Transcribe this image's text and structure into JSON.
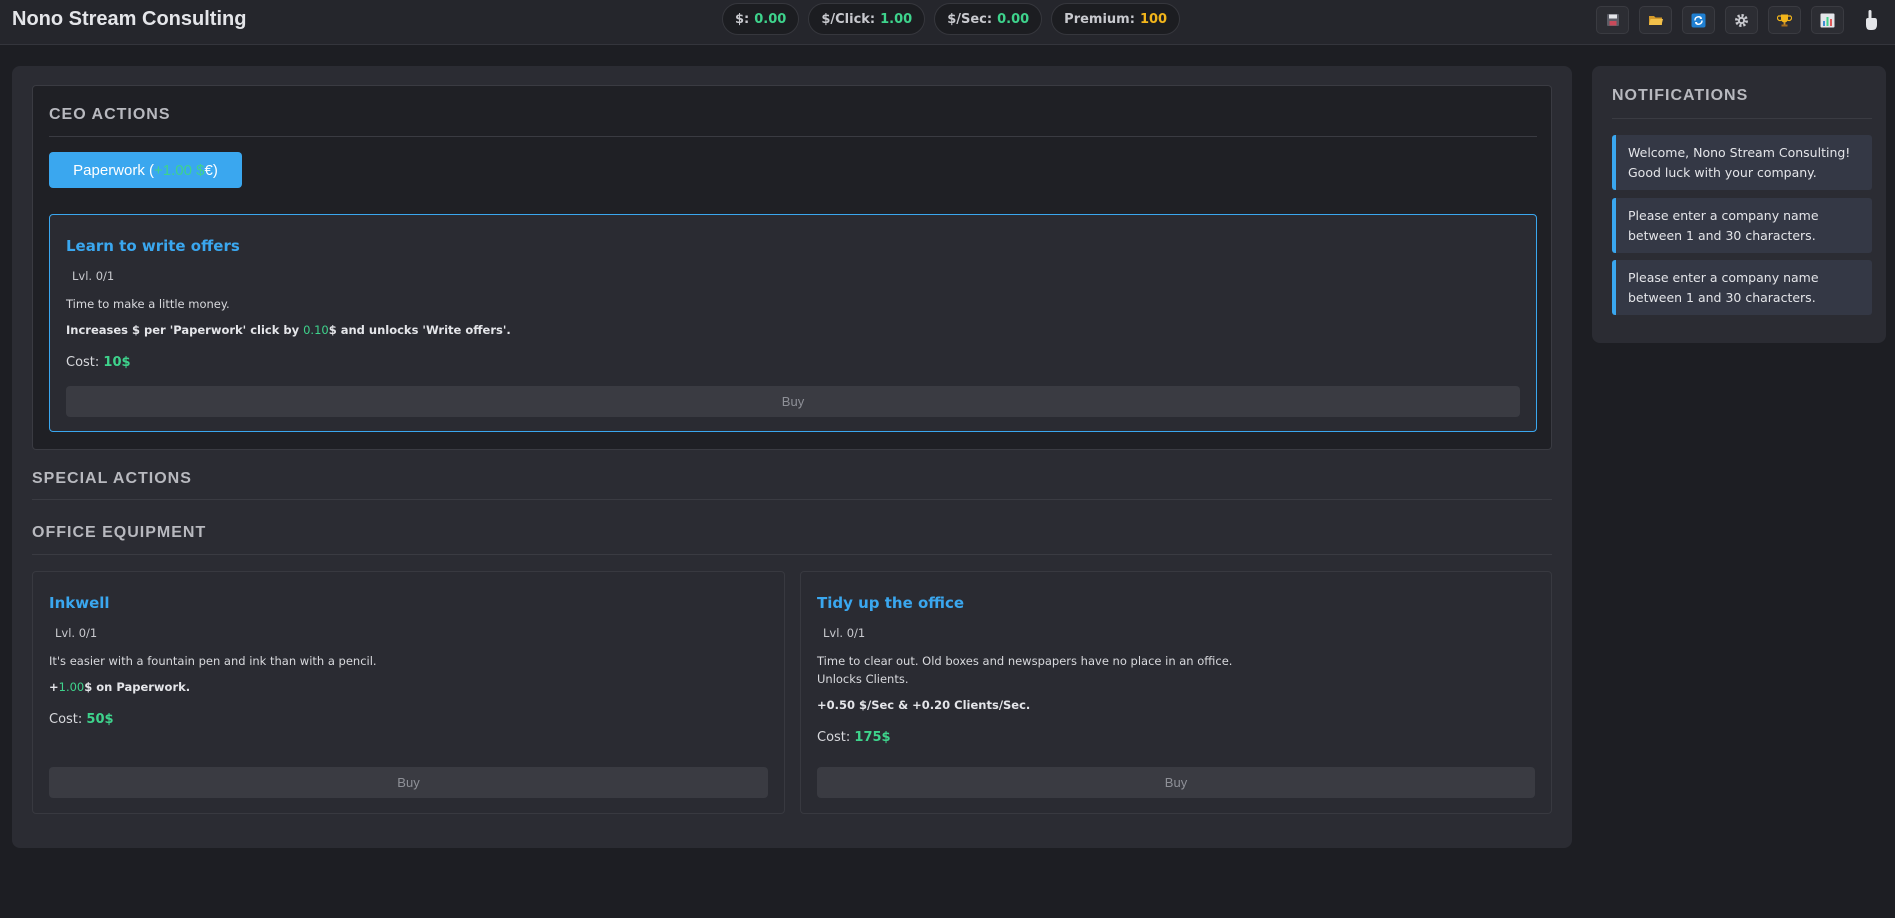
{
  "header": {
    "title": "Nono Stream Consulting",
    "stats": [
      {
        "label": "$:",
        "value": "0.00"
      },
      {
        "label": "$/Click:",
        "value": "1.00"
      },
      {
        "label": "$/Sec:",
        "value": "0.00"
      },
      {
        "label": "Premium:",
        "value": "100"
      }
    ],
    "toolbar_icons": [
      "save-icon",
      "folder-icon",
      "refresh-icon",
      "gear-icon",
      "trophy-icon",
      "chart-icon",
      "hand-icon"
    ]
  },
  "ceo": {
    "title": "CEO ACTIONS",
    "paperwork_button": {
      "label": "Paperwork (",
      "gain": "+1.00 $",
      "suffix": " €)"
    },
    "upgrade": {
      "title": "Learn to write offers",
      "level": "Lvl. 0/1",
      "description": "Time to make a little money.",
      "effect_prefix": "Increases $ per 'Paperwork' click by ",
      "effect_value": "0.10",
      "effect_suffix": "$ and unlocks 'Write offers'.",
      "cost_label": "Cost: ",
      "cost_value": "10$",
      "buy_label": "Buy"
    }
  },
  "special": {
    "title": "SPECIAL ACTIONS"
  },
  "office": {
    "title": "OFFICE EQUIPMENT",
    "items": [
      {
        "title": "Inkwell",
        "level": "Lvl. 0/1",
        "description": "It's easier with a fountain pen and ink than with a pencil.",
        "effect_prefix": "+",
        "effect_value": "1.00",
        "effect_suffix": "$ on Paperwork.",
        "cost_label": "Cost: ",
        "cost_value": "50$",
        "buy_label": "Buy"
      },
      {
        "title": "Tidy up the office",
        "level": "Lvl. 0/1",
        "description": "Time to clear out. Old boxes and newspapers have no place in an office.",
        "description2": "Unlocks Clients.",
        "effect": "+0.50 $/Sec & +0.20 Clients/Sec.",
        "cost_label": "Cost: ",
        "cost_value": "175$",
        "buy_label": "Buy"
      }
    ]
  },
  "notifications": {
    "title": "NOTIFICATIONS",
    "items": [
      "Welcome, Nono Stream Consulting! Good luck with your company.",
      "Please enter a company name between 1 and 30 characters.",
      "Please enter a company name between 1 and 30 characters."
    ]
  },
  "colors": {
    "accent": "#3aa7ef",
    "money": "#3ed38c",
    "premium": "#f2b51b"
  }
}
